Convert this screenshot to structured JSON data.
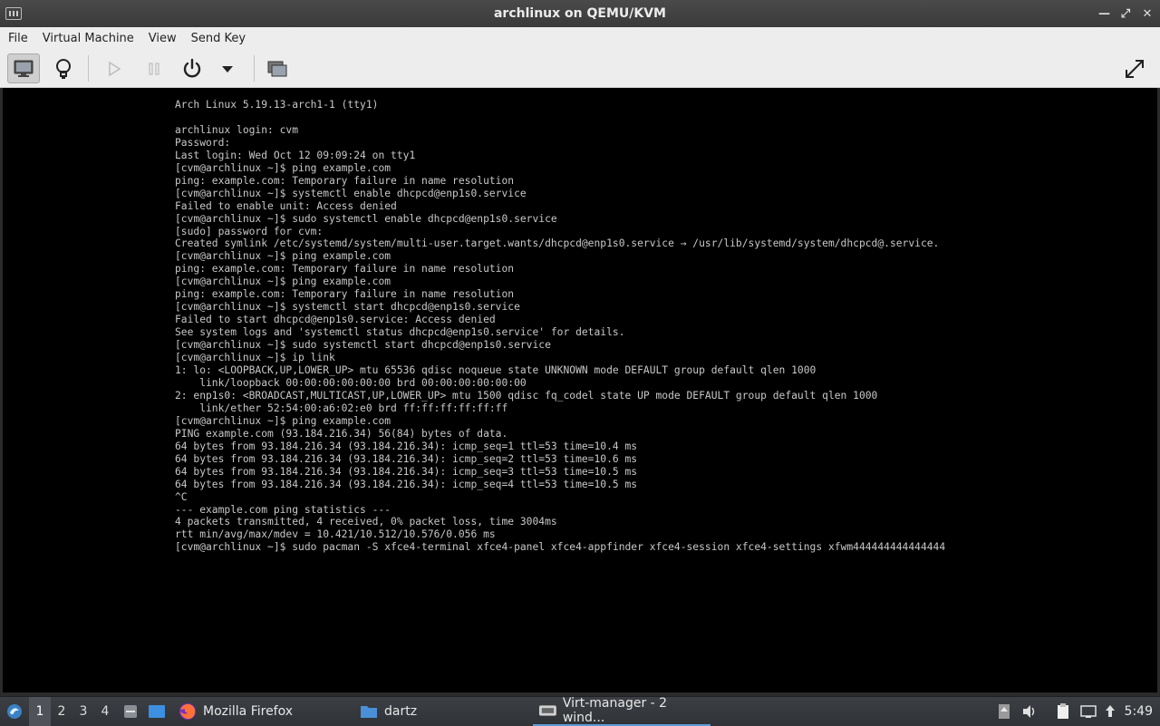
{
  "window": {
    "title": "archlinux on QEMU/KVM",
    "controls": [
      "minimize",
      "maximize",
      "close"
    ]
  },
  "menubar": {
    "items": [
      "File",
      "Virtual Machine",
      "View",
      "Send Key"
    ]
  },
  "toolbar": {
    "buttons": [
      {
        "name": "show-console",
        "icon": "monitor-icon",
        "active": true
      },
      {
        "name": "show-details",
        "icon": "lightbulb-icon",
        "active": false
      },
      {
        "name": "run",
        "icon": "play-icon",
        "enabled": false
      },
      {
        "name": "pause",
        "icon": "pause-icon",
        "enabled": false
      },
      {
        "name": "shutdown",
        "icon": "power-icon",
        "enabled": true
      },
      {
        "name": "shutdown-menu",
        "icon": "chevron-down-icon",
        "enabled": true
      },
      {
        "name": "snapshots",
        "icon": "screens-icon",
        "enabled": true
      },
      {
        "name": "fullscreen",
        "icon": "fullscreen-icon",
        "enabled": true
      }
    ]
  },
  "console": {
    "lines": [
      "Arch Linux 5.19.13-arch1-1 (tty1)",
      "",
      "archlinux login: cvm",
      "Password:",
      "Last login: Wed Oct 12 09:09:24 on tty1",
      "[cvm@archlinux ~]$ ping example.com",
      "ping: example.com: Temporary failure in name resolution",
      "[cvm@archlinux ~]$ systemctl enable dhcpcd@enp1s0.service",
      "Failed to enable unit: Access denied",
      "[cvm@archlinux ~]$ sudo systemctl enable dhcpcd@enp1s0.service",
      "[sudo] password for cvm:",
      "Created symlink /etc/systemd/system/multi-user.target.wants/dhcpcd@enp1s0.service → /usr/lib/systemd/system/dhcpcd@.service.",
      "[cvm@archlinux ~]$ ping example.com",
      "ping: example.com: Temporary failure in name resolution",
      "[cvm@archlinux ~]$ ping example.com",
      "ping: example.com: Temporary failure in name resolution",
      "[cvm@archlinux ~]$ systemctl start dhcpcd@enp1s0.service",
      "Failed to start dhcpcd@enp1s0.service: Access denied",
      "See system logs and 'systemctl status dhcpcd@enp1s0.service' for details.",
      "[cvm@archlinux ~]$ sudo systemctl start dhcpcd@enp1s0.service",
      "[cvm@archlinux ~]$ ip link",
      "1: lo: <LOOPBACK,UP,LOWER_UP> mtu 65536 qdisc noqueue state UNKNOWN mode DEFAULT group default qlen 1000",
      "    link/loopback 00:00:00:00:00:00 brd 00:00:00:00:00:00",
      "2: enp1s0: <BROADCAST,MULTICAST,UP,LOWER_UP> mtu 1500 qdisc fq_codel state UP mode DEFAULT group default qlen 1000",
      "    link/ether 52:54:00:a6:02:e0 brd ff:ff:ff:ff:ff:ff",
      "[cvm@archlinux ~]$ ping example.com",
      "PING example.com (93.184.216.34) 56(84) bytes of data.",
      "64 bytes from 93.184.216.34 (93.184.216.34): icmp_seq=1 ttl=53 time=10.4 ms",
      "64 bytes from 93.184.216.34 (93.184.216.34): icmp_seq=2 ttl=53 time=10.6 ms",
      "64 bytes from 93.184.216.34 (93.184.216.34): icmp_seq=3 ttl=53 time=10.5 ms",
      "64 bytes from 93.184.216.34 (93.184.216.34): icmp_seq=4 ttl=53 time=10.5 ms",
      "^C",
      "--- example.com ping statistics ---",
      "4 packets transmitted, 4 received, 0% packet loss, time 3004ms",
      "rtt min/avg/max/mdev = 10.421/10.512/10.576/0.056 ms",
      "[cvm@archlinux ~]$ sudo pacman -S xfce4-terminal xfce4-panel xfce4-appfinder xfce4-session xfce4-settings xfwm444444444444444"
    ]
  },
  "taskbar": {
    "workspaces": [
      "1",
      "2",
      "3",
      "4"
    ],
    "current_workspace": "1",
    "tasks": [
      {
        "label": "Mozilla Firefox",
        "icon": "firefox-icon"
      },
      {
        "label": "dartz",
        "icon": "folder-icon"
      },
      {
        "label": "Virt-manager - 2 wind...",
        "icon": "virt-manager-icon"
      }
    ],
    "clock": "5:49"
  },
  "colors": {
    "titlebar": "#3f3f3f",
    "console_bg": "#000000",
    "console_fg": "#c8c8c8",
    "taskbar": "#35383c",
    "accent": "#5e9bd6"
  }
}
